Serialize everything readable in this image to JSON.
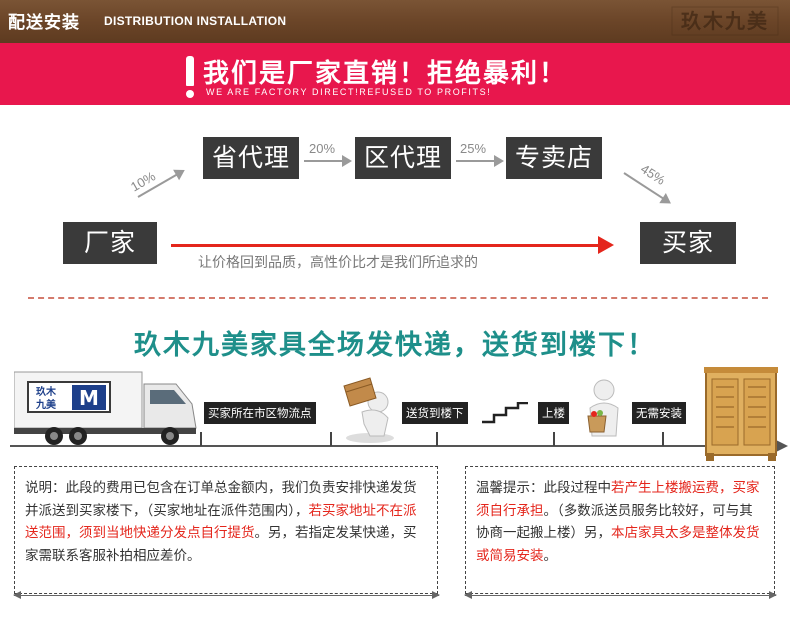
{
  "header": {
    "title": "配送安装",
    "subtitle": "DISTRIBUTION INSTALLATION",
    "brand_logo": "玖木九美"
  },
  "banner": {
    "title": "我们是厂家直销！拒绝暴利！",
    "subtitle": "WE ARE FACTORY DIRECT!REFUSED TO PROFITS!"
  },
  "chain": {
    "factory": "厂家",
    "buyer": "买家",
    "stages": [
      "省代理",
      "区代理",
      "专卖店"
    ],
    "percentages": [
      "10%",
      "20%",
      "25%",
      "45%"
    ],
    "slogan": "让价格回到品质，高性价比才是我们所追求的"
  },
  "headline": "玖木九美家具全场发快递，送货到楼下！",
  "logistics": {
    "logo_text": "玖木九美",
    "steps": [
      "买家所在市区物流点",
      "送货到楼下",
      "上楼",
      "无需安装"
    ]
  },
  "info_left": {
    "p1": "说明：此段的费用已包含在订单总金额内，我们负责安排快递发货并派送到买家楼下，（买家地址在派件范围内），",
    "p2_red": "若买家地址不在派送范围，须到当地快递分发点自行提货",
    "p3": "。另，若指定发某快递，买家需联系客服补拍相应差价。"
  },
  "info_right": {
    "p1": "温馨提示：此段过程中",
    "p2_red": "若产生上楼搬运费，买家须自行承担",
    "p3": "。（多数派送员服务比较好，可与其协商一起搬上楼）另，",
    "p4_red": "本店家具太多是整体发货或简易安装",
    "p5": "。"
  },
  "colors": {
    "banner": "#e8174d",
    "headline": "#1e8f8a",
    "accent_red": "#e4261c",
    "dark_box": "#3a3a3a"
  }
}
